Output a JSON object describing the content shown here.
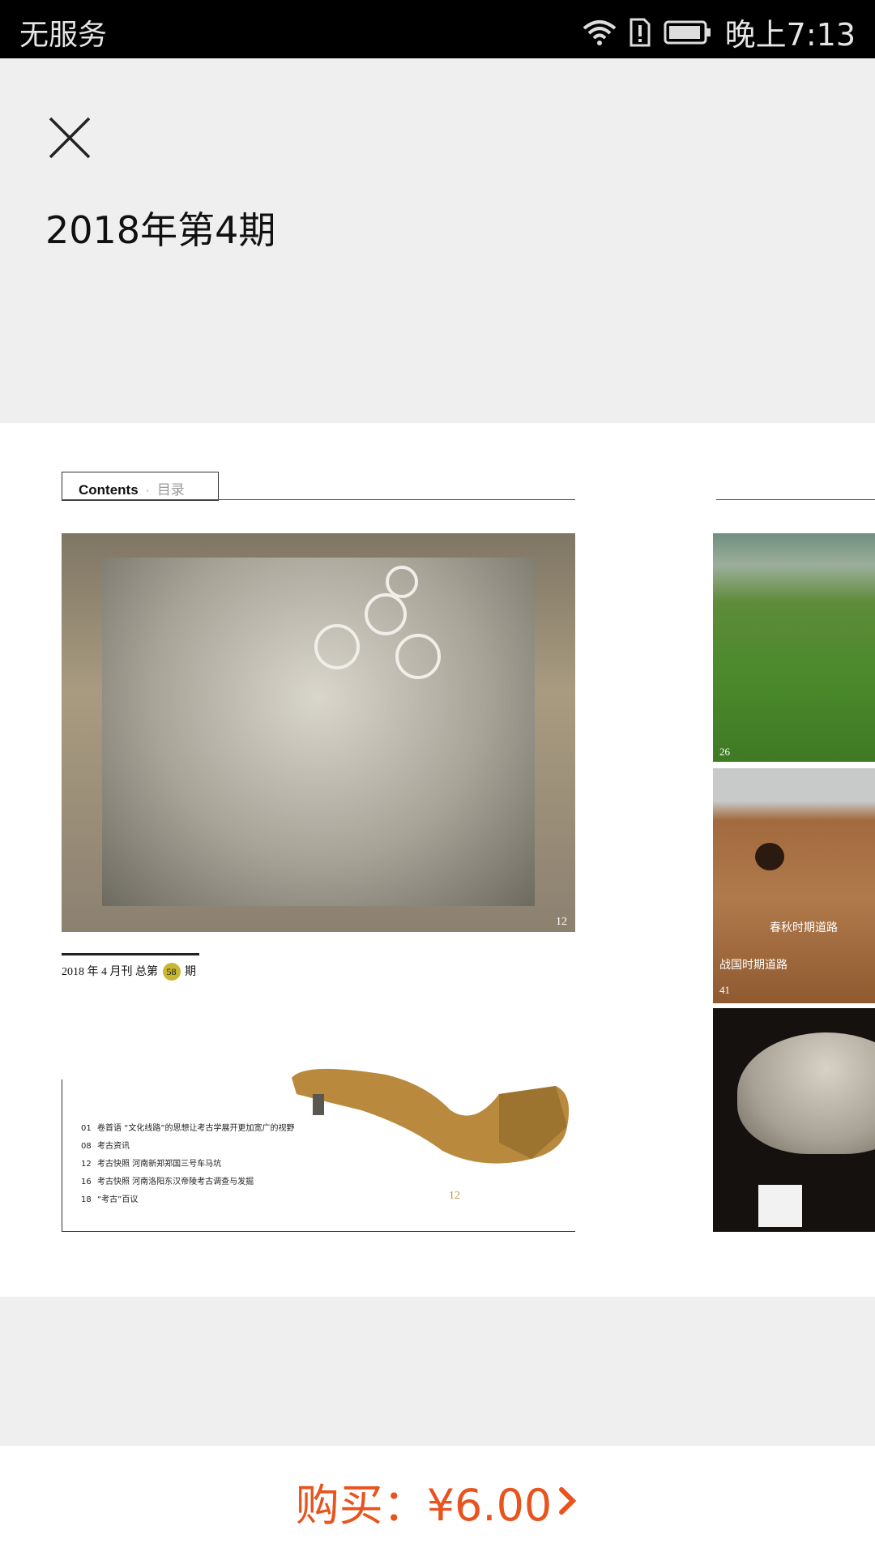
{
  "status_bar": {
    "carrier": "无服务",
    "time": "晚上7:13",
    "icons": [
      "wifi-icon",
      "sim-alert-icon",
      "battery-icon"
    ]
  },
  "header": {
    "close_icon": "close-icon",
    "issue_title": "2018年第4期"
  },
  "preview": {
    "contents_label": "Contents",
    "contents_sep": "·",
    "contents_zh": "目录",
    "main_photo_page": "12",
    "date_prefix": "2018 年 4 月刊  总第",
    "issue_total": "58",
    "date_suffix": "期",
    "toc": [
      {
        "num": "01",
        "text": "卷首语   “文化线路”的思想让考古学展开更加宽广的视野"
      },
      {
        "num": "08",
        "text": "考古资讯"
      },
      {
        "num": "12",
        "text": "考古快照   河南新郑郑国三号车马坑"
      },
      {
        "num": "16",
        "text": "考古快照   河南洛阳东汉帝陵考古调查与发掘"
      },
      {
        "num": "18",
        "text": "“考古”百议"
      }
    ],
    "artifact_page": "12",
    "side_field_page": "26",
    "side_cliff_label_1": "春秋时期道路",
    "side_cliff_label_2": "战国时期道路",
    "side_cliff_page": "41"
  },
  "buy": {
    "label": "购买：¥6.00",
    "icon": "chevron-right-icon",
    "accent_color": "#e8531e"
  }
}
